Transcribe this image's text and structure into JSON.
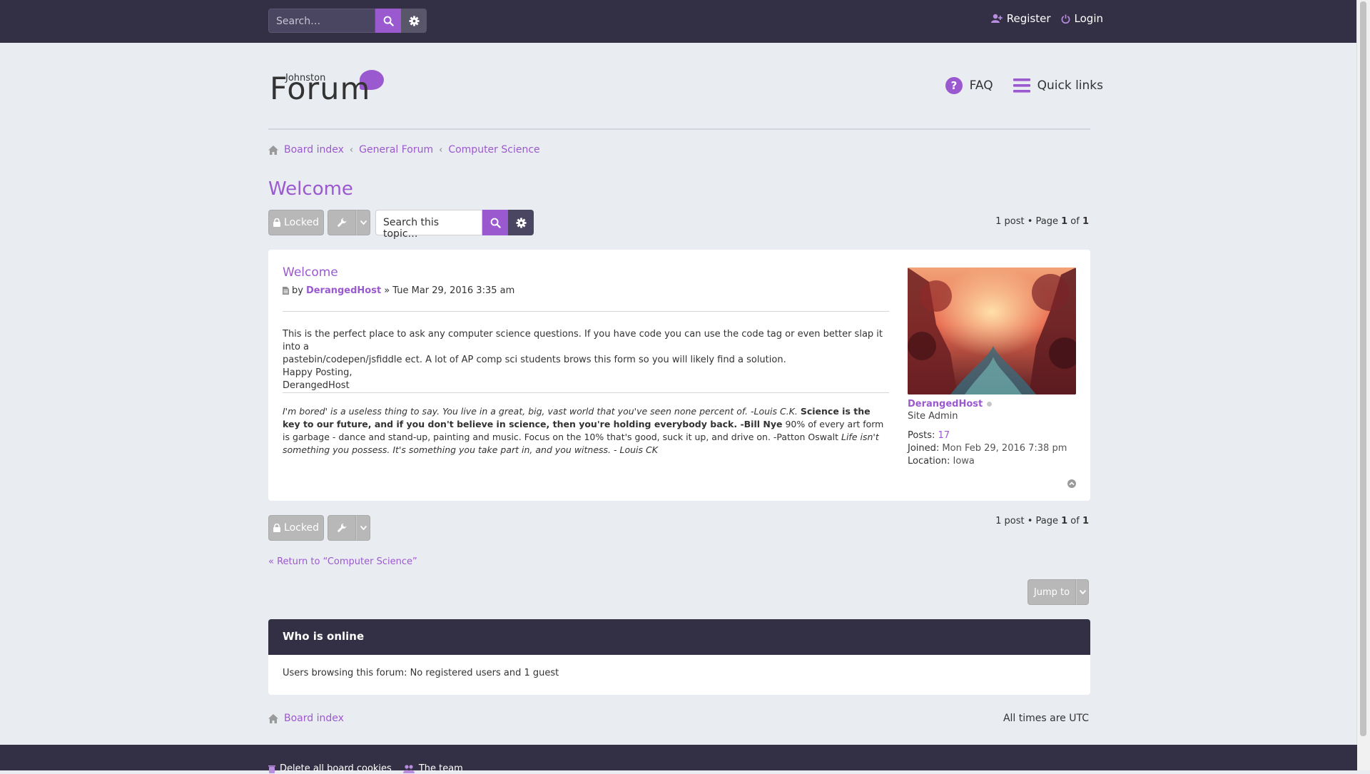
{
  "topbar": {
    "search_placeholder": "Search…",
    "register_label": "Register",
    "login_label": "Login"
  },
  "header": {
    "logo_small": "Johnston",
    "logo_big": "Forum",
    "faq_label": "FAQ",
    "quicklinks_label": "Quick links"
  },
  "breadcrumb": {
    "items": [
      "Board index",
      "General Forum",
      "Computer Science"
    ]
  },
  "page_title": "Welcome",
  "actions": {
    "locked_label": "Locked",
    "topic_search_placeholder": "Search this topic…",
    "page_info_prefix": "1 post • Page ",
    "page_current": "1",
    "page_of": " of ",
    "page_total": "1"
  },
  "post": {
    "title": "Welcome",
    "by": "by",
    "author": "DerangedHost",
    "date": "» Tue Mar 29, 2016 3:35 am",
    "content_lines": [
      "This is the perfect place to ask any computer science questions. If you have code you can use the code tag or even better slap it into a",
      "pastebin/codepen/jsfiddle ect. A lot of AP comp sci students brows this form so you will likely find a solution.",
      "Happy Posting,",
      "DerangedHost"
    ],
    "signature": {
      "part1": "I'm bored' is a useless thing to say. You live in a great, big, vast world that you've seen none percent of. -Louis C.K.",
      "part2": "Science is the key to our future, and if you don't believe in science, then you're holding everybody back. -Bill Nye",
      "part3": "90% of every art form is garbage - dance and stand-up, painting and music. Focus on the 10% that's good, suck it up, and drive on. -Patton Oswalt",
      "part4": "Life isn't something you possess. It's something you take part in, and you witness. - Louis CK"
    }
  },
  "profile": {
    "name": "DerangedHost",
    "rank": "Site Admin",
    "posts_label": "Posts:",
    "posts_value": "17",
    "joined_label": "Joined:",
    "joined_value": "Mon Feb 29, 2016 7:38 pm",
    "location_label": "Location:",
    "location_value": "Iowa"
  },
  "return_link": "Return to “Computer Science”",
  "jump_label": "Jump to",
  "online": {
    "title": "Who is online",
    "text": "Users browsing this forum: No registered users and 1 guest"
  },
  "footer": {
    "board_index": "Board index",
    "timezone": "All times are UTC",
    "delete_cookies": "Delete all board cookies",
    "team": "The team"
  },
  "colors": {
    "accent": "#9b59d0",
    "dark_bar": "#332f44",
    "background": "#e9ecf1"
  }
}
